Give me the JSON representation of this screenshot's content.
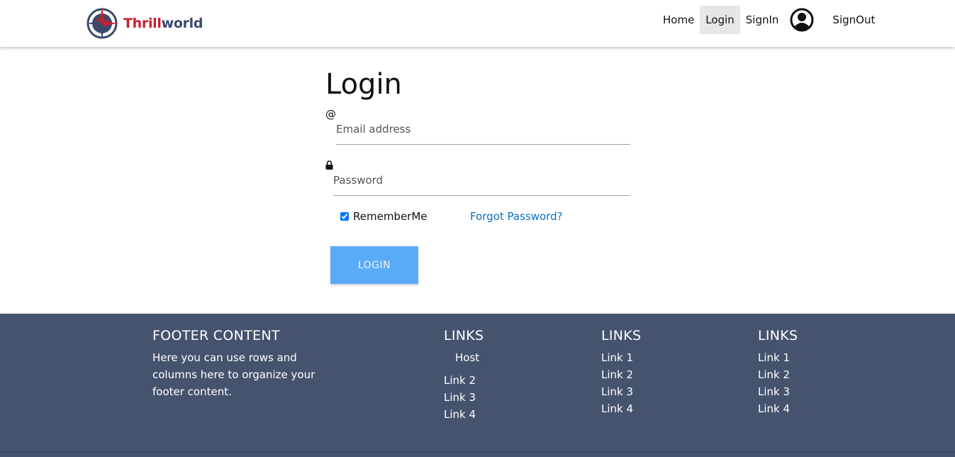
{
  "brand": {
    "name_part1": "Thrill",
    "name_part2": "world",
    "logo_icon": "compass-globe-icon",
    "colors": {
      "red": "#c8202f",
      "navy": "#3b4a6b"
    }
  },
  "nav": {
    "items": [
      {
        "label": "Home"
      },
      {
        "label": "Login",
        "active": true
      },
      {
        "label": "SignIn"
      }
    ],
    "avatar_icon": "user-circle-icon",
    "signout_label": "SignOut"
  },
  "login": {
    "title": "Login",
    "email_icon": "@",
    "email_placeholder": "Email address",
    "password_icon": "lock-icon",
    "password_placeholder": "Password",
    "remember_label": "RememberMe",
    "remember_checked": true,
    "forgot_label": "Forgot Password?",
    "button_label": "LOGIN",
    "button_color": "#5aabf7",
    "link_color": "#0d6fbf"
  },
  "footer": {
    "background": "#46536e",
    "content_title": "FOOTER CONTENT",
    "content_text": "Here you can use rows and columns here to organize your footer content.",
    "columns": [
      {
        "title": "LINKS",
        "links": [
          "Host",
          "Link 2",
          "Link 3",
          "Link 4"
        ]
      },
      {
        "title": "LINKS",
        "links": [
          "Link 1",
          "Link 2",
          "Link 3",
          "Link 4"
        ]
      },
      {
        "title": "LINKS",
        "links": [
          "Link 1",
          "Link 2",
          "Link 3",
          "Link 4"
        ]
      }
    ]
  }
}
